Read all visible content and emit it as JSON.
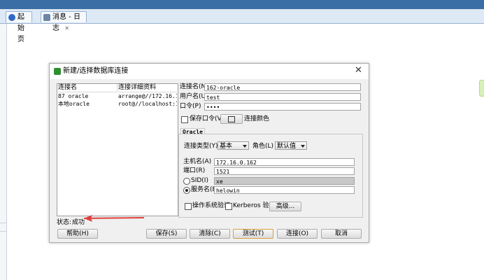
{
  "tabs": {
    "start_label": "起始页",
    "log_label": "消息 - 日志"
  },
  "dialog": {
    "title": "新建/选择数据库连接",
    "close_glyph": "✕"
  },
  "connections": {
    "columns": [
      "连接名",
      "连接详细资料"
    ],
    "rows": [
      {
        "name": "87 oracle",
        "detail": "arrange@//172.16.1..."
      },
      {
        "name": "本地oracle",
        "detail": "root@//localhost:15..."
      }
    ]
  },
  "status": {
    "label": "状态:",
    "value": "成功"
  },
  "form": {
    "conn_name_label": "连接名(N)",
    "conn_name_value": "162-oracle",
    "user_label": "用户名(U)",
    "user_value": "test",
    "password_label": "口令(P)",
    "password_value": "••••",
    "save_password_label": "保存口令(V)",
    "conn_color_label": "连接颜色",
    "oracle_tab": "Oracle",
    "conn_type_label": "连接类型(Y)",
    "conn_type_value": "基本",
    "role_label": "角色(L)",
    "role_value": "默认值",
    "host_label": "主机名(A)",
    "host_value": "172.16.0.162",
    "port_label": "端口(R)",
    "port_value": "1521",
    "sid_label": "SID(I)",
    "sid_value": "xe",
    "service_label": "服务名(E)",
    "service_value": "helowin",
    "os_auth_label": "操作系统验证",
    "kerberos_label": "Kerberos 验证",
    "advanced_label": "高级..."
  },
  "buttons": {
    "help": "帮助(H)",
    "save": "保存(S)",
    "clear": "清除(C)",
    "test": "测试(T)",
    "connect": "连接(O)",
    "cancel": "取消"
  },
  "colors": {
    "chrome_blue": "#3a6ea5",
    "arrow_red": "#e0403a",
    "focus_gold": "#d4a23a"
  }
}
